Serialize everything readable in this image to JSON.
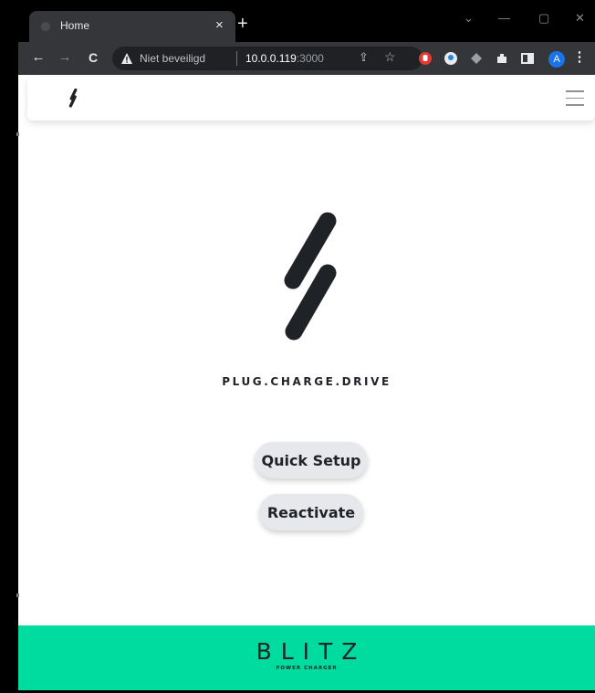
{
  "browser": {
    "tab_title": "Home",
    "tab_close": "×",
    "new_tab": "+",
    "window_controls": {
      "dropdown": "⌄",
      "minimize": "—",
      "maximize": "▢",
      "close": "✕"
    },
    "security_label": "Niet beveiligd",
    "url_host": "10.0.0.119",
    "url_port": ":3000",
    "profile_initial": "A"
  },
  "navbar": {
    "logo_icon": "bolt-slash-logo",
    "menu_icon": "hamburger-icon"
  },
  "hero": {
    "tagline": "PLUG.CHARGE.DRIVE",
    "quick_setup_label": "Quick Setup",
    "reactivate_label": "Reactivate"
  },
  "footer": {
    "brand": "BLITZ",
    "subbrand": "POWER CHARGER",
    "background": "#00dba0"
  },
  "colors": {
    "dark": "#1f2227",
    "button_bg": "#e7e8ec"
  }
}
